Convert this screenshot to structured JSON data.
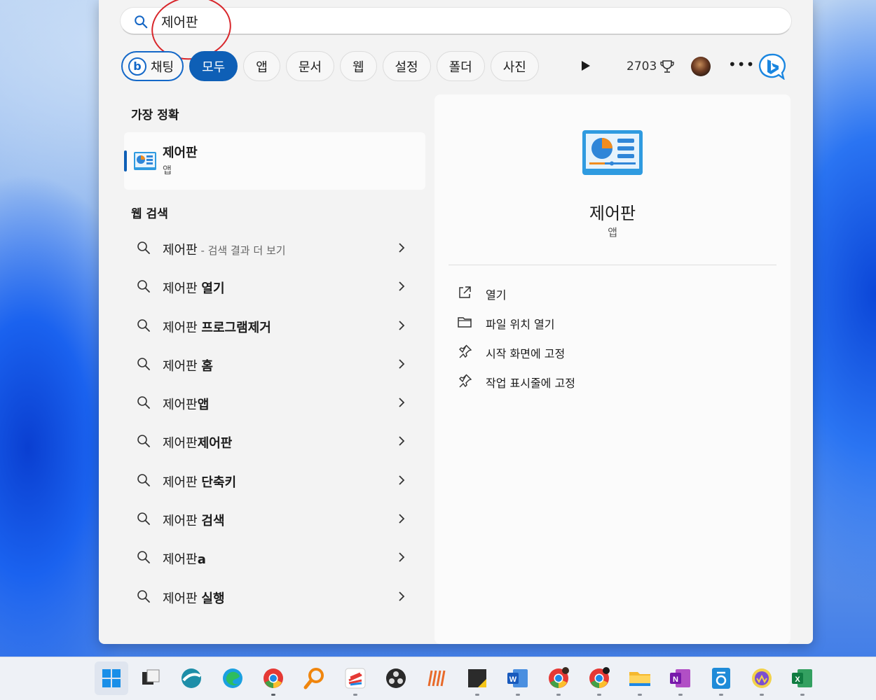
{
  "search": {
    "query": "제어판"
  },
  "filters": {
    "chat_label": "채팅",
    "items": [
      "모두",
      "앱",
      "문서",
      "웹",
      "설정",
      "폴더",
      "사진"
    ],
    "active": "모두",
    "rewards_points": "2703"
  },
  "best_match": {
    "section_title": "가장 정확",
    "name": "제어판",
    "type": "앱"
  },
  "web_search": {
    "section_title": "웹 검색",
    "items": [
      {
        "query": "제어판",
        "rest": "",
        "hint": " - 검색 결과 더 보기"
      },
      {
        "query": "제어판 ",
        "rest": "열기",
        "hint": ""
      },
      {
        "query": "제어판 ",
        "rest": "프로그램제거",
        "hint": ""
      },
      {
        "query": "제어판 ",
        "rest": "홈",
        "hint": ""
      },
      {
        "query": "제어판",
        "rest": "앱",
        "hint": ""
      },
      {
        "query": "제어판",
        "rest": "제어판",
        "hint": ""
      },
      {
        "query": "제어판 ",
        "rest": "단축키",
        "hint": ""
      },
      {
        "query": "제어판 ",
        "rest": "검색",
        "hint": ""
      },
      {
        "query": "제어판",
        "rest": "a",
        "hint": ""
      },
      {
        "query": "제어판 ",
        "rest": "실행",
        "hint": ""
      }
    ]
  },
  "preview": {
    "name": "제어판",
    "type": "앱",
    "actions": [
      {
        "label": "열기",
        "icon": "open-external-icon"
      },
      {
        "label": "파일 위치 열기",
        "icon": "folder-icon"
      },
      {
        "label": "시작 화면에 고정",
        "icon": "pin-icon"
      },
      {
        "label": "작업 표시줄에 고정",
        "icon": "pin-icon"
      }
    ]
  },
  "colors": {
    "accent": "#0e5fb6",
    "annotation": "#d8262b",
    "panel": "#f3f3f3"
  },
  "taskbar": {
    "apps": [
      {
        "name": "start-icon",
        "dot": false
      },
      {
        "name": "task-view-icon",
        "dot": false
      },
      {
        "name": "sphere-app-icon",
        "dot": false
      },
      {
        "name": "edge-icon",
        "dot": false
      },
      {
        "name": "chrome-icon",
        "dot": true
      },
      {
        "name": "search-magnifier-app-icon",
        "dot": false
      },
      {
        "name": "colorful-app-icon",
        "dot": true
      },
      {
        "name": "obs-icon",
        "dot": false
      },
      {
        "name": "stripes-app-icon",
        "dot": false
      },
      {
        "name": "sticky-notes-icon",
        "dot": true
      },
      {
        "name": "word-icon",
        "dot": true
      },
      {
        "name": "chrome-profile-icon-1",
        "dot": true
      },
      {
        "name": "chrome-profile-icon-2",
        "dot": true
      },
      {
        "name": "file-explorer-icon",
        "dot": true
      },
      {
        "name": "onenote-icon",
        "dot": true
      },
      {
        "name": "hangul-icon",
        "dot": true
      },
      {
        "name": "whale-app-icon",
        "dot": true
      },
      {
        "name": "excel-icon",
        "dot": true
      }
    ]
  }
}
